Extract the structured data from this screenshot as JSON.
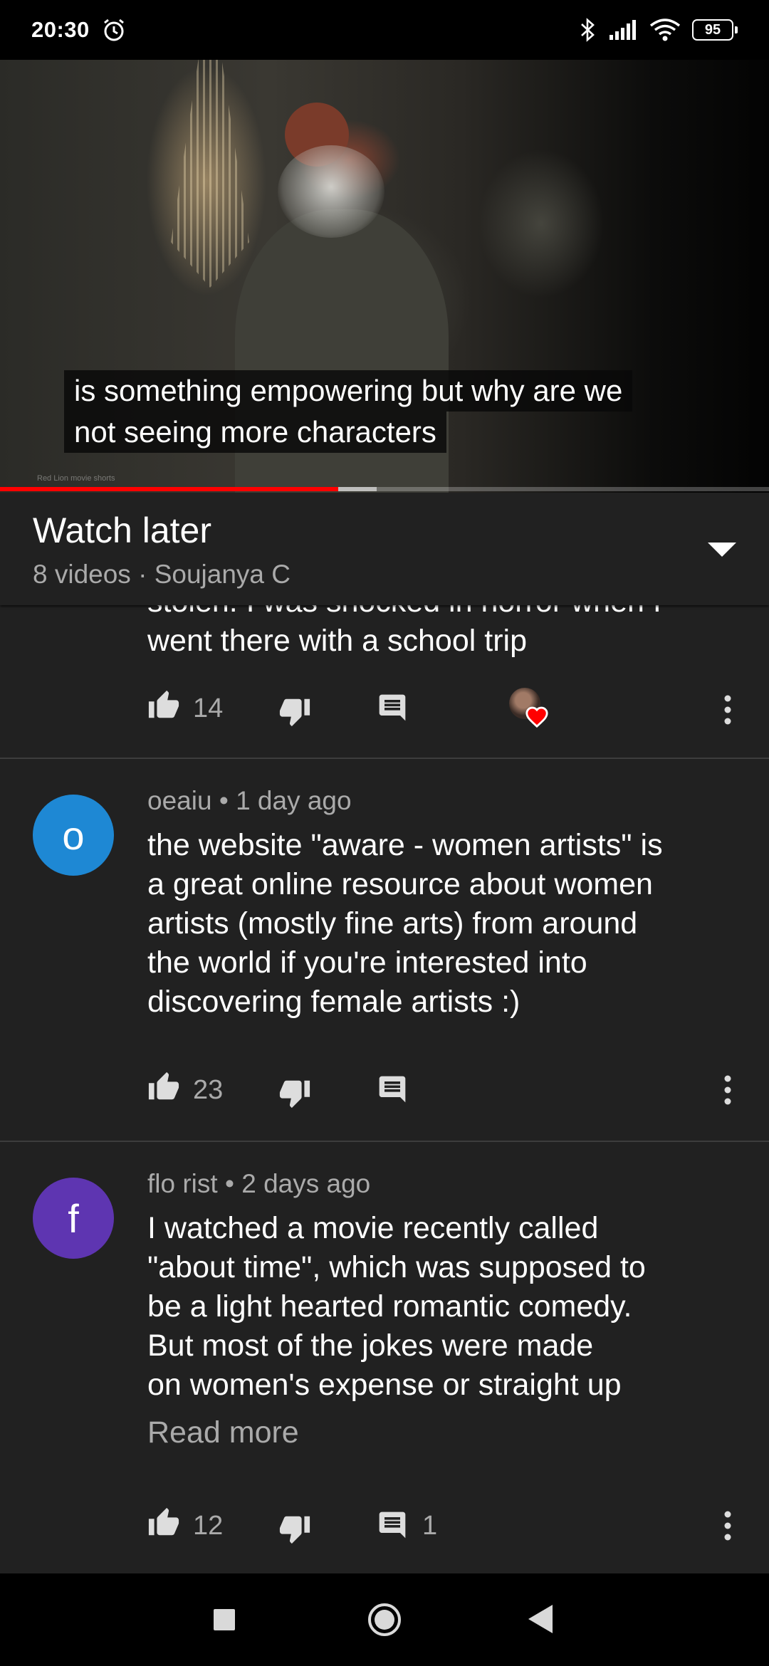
{
  "status_bar": {
    "time": "20:30",
    "battery": "95",
    "icons": [
      "alarm-icon",
      "bluetooth-icon",
      "signal-icon",
      "wifi-icon",
      "battery-icon"
    ]
  },
  "video": {
    "caption_line1": "is something empowering but why are we",
    "caption_line2": "not seeing more characters",
    "watermark": "Red Lion movie shorts",
    "progress_fraction": 0.44,
    "buffer_fraction": 0.49,
    "progress_color": "#ff0000"
  },
  "playlist": {
    "title": "Watch later",
    "subtitle": "8 videos · Soujanya C"
  },
  "comments": [
    {
      "partial_text_line1": "stolen. I was shocked in horror when I",
      "partial_text_line2": "went there with a school trip",
      "likes": "14",
      "creator_hearted": true
    },
    {
      "avatar_letter": "o",
      "avatar_color": "#1e88d4",
      "author": "oeaiu",
      "time": "1 day ago",
      "text_lines": [
        "the website \"aware - women artists\" is",
        "a great online resource about women",
        "artists (mostly fine arts) from around",
        "the world if you're interested into",
        "discovering female artists :)"
      ],
      "likes": "23"
    },
    {
      "avatar_letter": "f",
      "avatar_color": "#5e35b1",
      "author": "flo rist",
      "time": "2 days ago",
      "text_lines": [
        "I watched a movie recently called",
        "\"about time\", which was supposed to",
        "be a light hearted romantic comedy.",
        "But most of the jokes were made",
        "on women's expense or straight up"
      ],
      "read_more": "Read more",
      "likes": "12",
      "replies": "1"
    }
  ],
  "separator": "•"
}
